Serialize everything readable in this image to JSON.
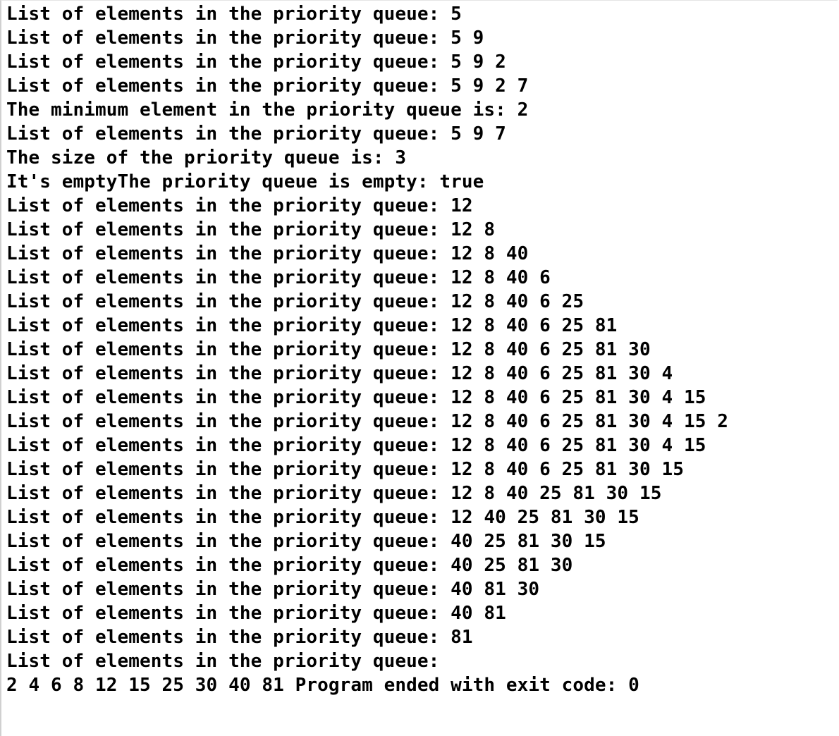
{
  "console": {
    "lines": [
      "List of elements in the priority queue: 5",
      "List of elements in the priority queue: 5 9",
      "List of elements in the priority queue: 5 9 2",
      "List of elements in the priority queue: 5 9 2 7",
      "The minimum element in the priority queue is: 2",
      "List of elements in the priority queue: 5 9 7",
      "The size of the priority queue is: 3",
      "It's emptyThe priority queue is empty: true",
      "List of elements in the priority queue: 12",
      "List of elements in the priority queue: 12 8",
      "List of elements in the priority queue: 12 8 40",
      "List of elements in the priority queue: 12 8 40 6",
      "List of elements in the priority queue: 12 8 40 6 25",
      "List of elements in the priority queue: 12 8 40 6 25 81",
      "List of elements in the priority queue: 12 8 40 6 25 81 30",
      "List of elements in the priority queue: 12 8 40 6 25 81 30 4",
      "List of elements in the priority queue: 12 8 40 6 25 81 30 4 15",
      "List of elements in the priority queue: 12 8 40 6 25 81 30 4 15 2",
      "List of elements in the priority queue: 12 8 40 6 25 81 30 4 15",
      "List of elements in the priority queue: 12 8 40 6 25 81 30 15",
      "List of elements in the priority queue: 12 8 40 25 81 30 15",
      "List of elements in the priority queue: 12 40 25 81 30 15",
      "List of elements in the priority queue: 40 25 81 30 15",
      "List of elements in the priority queue: 40 25 81 30",
      "List of elements in the priority queue: 40 81 30",
      "List of elements in the priority queue: 40 81",
      "List of elements in the priority queue: 81",
      "List of elements in the priority queue:",
      "2 4 6 8 12 15 25 30 40 81 Program ended with exit code: 0"
    ]
  }
}
